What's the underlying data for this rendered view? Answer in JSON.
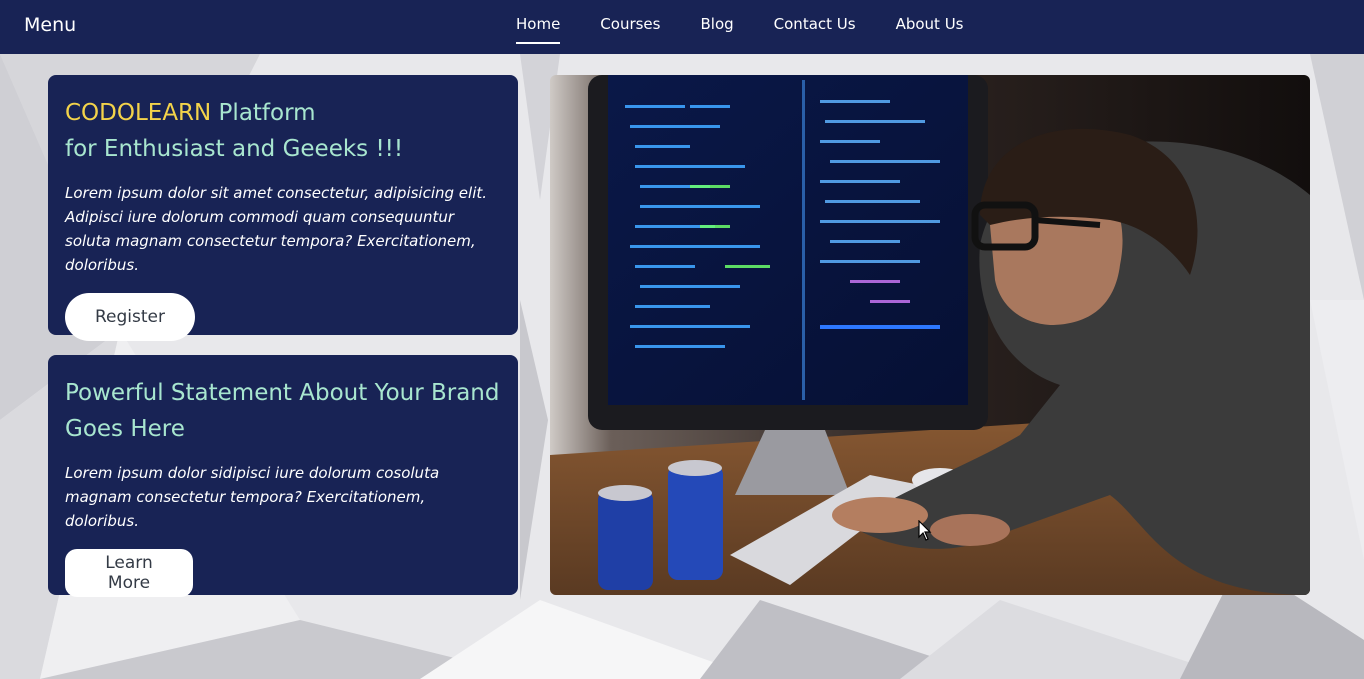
{
  "nav": {
    "brand": "Menu",
    "links": [
      {
        "label": "Home",
        "active": true
      },
      {
        "label": "Courses",
        "active": false
      },
      {
        "label": "Blog",
        "active": false
      },
      {
        "label": "Contact Us",
        "active": false
      },
      {
        "label": "About Us",
        "active": false
      }
    ]
  },
  "card1": {
    "heading_accent": "CODOLEARN",
    "heading_rest": " Platform",
    "heading_line2": "for Enthusiast and Geeeks !!!",
    "text": "Lorem ipsum dolor sit amet consectetur, adipisicing elit. Adipisci iure dolorum commodi quam consequuntur soluta magnam consectetur tempora? Exercitationem, doloribus.",
    "button": "Register"
  },
  "card2": {
    "heading": "Powerful Statement About Your Brand Goes Here",
    "text": "Lorem ipsum dolor sidipisci iure dolorum cosoluta magnam consectetur tempora? Exercitationem, doloribus.",
    "button": "Learn More"
  },
  "colors": {
    "navy": "#182355",
    "accent_yellow": "#f3d34a",
    "heading_mint": "#a8e6cf"
  },
  "hero_image": "programmer-at-computer-photo"
}
